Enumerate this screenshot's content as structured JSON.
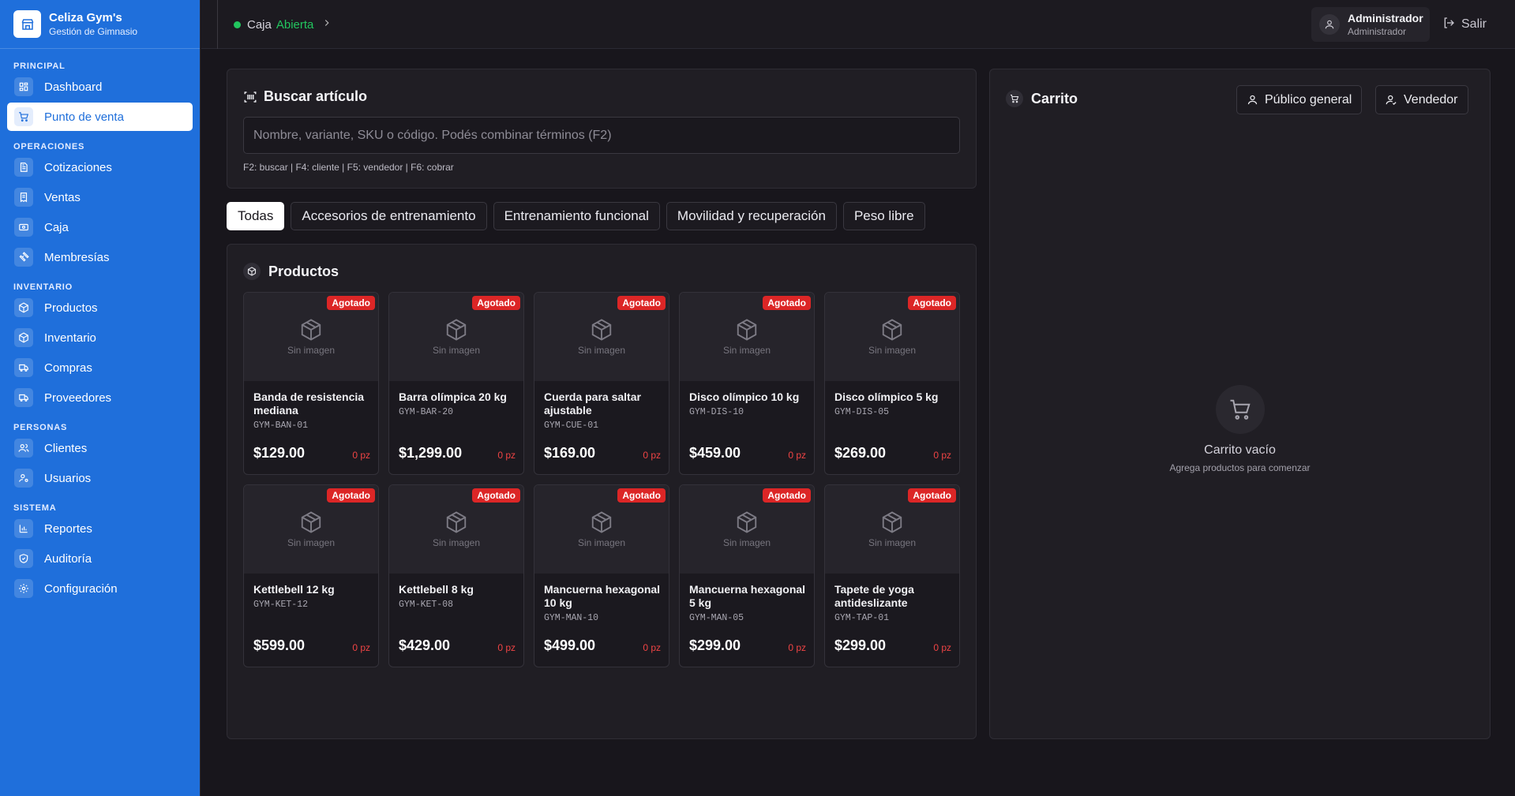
{
  "brand": {
    "title": "Celiza Gym's",
    "subtitle": "Gestión de Gimnasio"
  },
  "sidebar": {
    "sections": [
      {
        "label": "PRINCIPAL",
        "items": [
          {
            "label": "Dashboard",
            "icon": "dashboard-icon",
            "active": false
          },
          {
            "label": "Punto de venta",
            "icon": "cart-icon",
            "active": true
          }
        ]
      },
      {
        "label": "OPERACIONES",
        "items": [
          {
            "label": "Cotizaciones",
            "icon": "document-icon",
            "active": false
          },
          {
            "label": "Ventas",
            "icon": "receipt-icon",
            "active": false
          },
          {
            "label": "Caja",
            "icon": "cash-icon",
            "active": false
          },
          {
            "label": "Membresías",
            "icon": "dumbbell-icon",
            "active": false
          }
        ]
      },
      {
        "label": "INVENTARIO",
        "items": [
          {
            "label": "Productos",
            "icon": "package-icon",
            "active": false
          },
          {
            "label": "Inventario",
            "icon": "package-icon",
            "active": false
          },
          {
            "label": "Compras",
            "icon": "truck-icon",
            "active": false
          },
          {
            "label": "Proveedores",
            "icon": "truck-icon",
            "active": false
          }
        ]
      },
      {
        "label": "PERSONAS",
        "items": [
          {
            "label": "Clientes",
            "icon": "users-icon",
            "active": false
          },
          {
            "label": "Usuarios",
            "icon": "user-cog-icon",
            "active": false
          }
        ]
      },
      {
        "label": "SISTEMA",
        "items": [
          {
            "label": "Reportes",
            "icon": "bar-chart-icon",
            "active": false
          },
          {
            "label": "Auditoría",
            "icon": "shield-icon",
            "active": false
          },
          {
            "label": "Configuración",
            "icon": "gear-icon",
            "active": false
          }
        ]
      }
    ]
  },
  "topbar": {
    "caja_label": "Caja",
    "caja_status": "Abierta",
    "user_name": "Administrador",
    "user_role": "Administrador",
    "logout_label": "Salir"
  },
  "search": {
    "title": "Buscar artículo",
    "placeholder": "Nombre, variante, SKU o código. Podés combinar términos (F2)",
    "value": "",
    "hint": "F2: buscar | F4: cliente | F5: vendedor | F6: cobrar"
  },
  "categories": [
    {
      "label": "Todas",
      "active": true
    },
    {
      "label": "Accesorios de entrenamiento",
      "active": false
    },
    {
      "label": "Entrenamiento funcional",
      "active": false
    },
    {
      "label": "Movilidad y recuperación",
      "active": false
    },
    {
      "label": "Peso libre",
      "active": false
    }
  ],
  "products_panel": {
    "title": "Productos"
  },
  "products": [
    {
      "name": "Banda de resistencia mediana",
      "sku": "GYM-BAN-01",
      "price": "$129.00",
      "stock": "0 pz",
      "badge": "Agotado",
      "image_label": "Sin imagen"
    },
    {
      "name": "Barra olímpica 20 kg",
      "sku": "GYM-BAR-20",
      "price": "$1,299.00",
      "stock": "0 pz",
      "badge": "Agotado",
      "image_label": "Sin imagen"
    },
    {
      "name": "Cuerda para saltar ajustable",
      "sku": "GYM-CUE-01",
      "price": "$169.00",
      "stock": "0 pz",
      "badge": "Agotado",
      "image_label": "Sin imagen"
    },
    {
      "name": "Disco olímpico 10 kg",
      "sku": "GYM-DIS-10",
      "price": "$459.00",
      "stock": "0 pz",
      "badge": "Agotado",
      "image_label": "Sin imagen"
    },
    {
      "name": "Disco olímpico 5 kg",
      "sku": "GYM-DIS-05",
      "price": "$269.00",
      "stock": "0 pz",
      "badge": "Agotado",
      "image_label": "Sin imagen"
    },
    {
      "name": "Kettlebell 12 kg",
      "sku": "GYM-KET-12",
      "price": "$599.00",
      "stock": "0 pz",
      "badge": "Agotado",
      "image_label": "Sin imagen"
    },
    {
      "name": "Kettlebell 8 kg",
      "sku": "GYM-KET-08",
      "price": "$429.00",
      "stock": "0 pz",
      "badge": "Agotado",
      "image_label": "Sin imagen"
    },
    {
      "name": "Mancuerna hexagonal 10 kg",
      "sku": "GYM-MAN-10",
      "price": "$499.00",
      "stock": "0 pz",
      "badge": "Agotado",
      "image_label": "Sin imagen"
    },
    {
      "name": "Mancuerna hexagonal 5 kg",
      "sku": "GYM-MAN-05",
      "price": "$299.00",
      "stock": "0 pz",
      "badge": "Agotado",
      "image_label": "Sin imagen"
    },
    {
      "name": "Tapete de yoga antideslizante",
      "sku": "GYM-TAP-01",
      "price": "$299.00",
      "stock": "0 pz",
      "badge": "Agotado",
      "image_label": "Sin imagen"
    }
  ],
  "cart": {
    "title": "Carrito",
    "customer_button": "Público general",
    "seller_button": "Vendedor",
    "empty_title": "Carrito vacío",
    "empty_subtitle": "Agrega productos para comenzar"
  },
  "colors": {
    "sidebar": "#1f6fdb",
    "accent_green": "#22c55e",
    "danger": "#dc2626",
    "background": "#18161c"
  }
}
